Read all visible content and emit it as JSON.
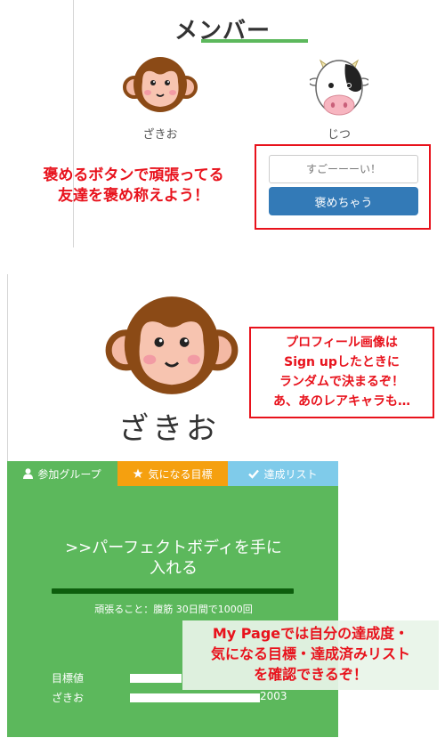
{
  "members_panel": {
    "title": "メンバー",
    "members": [
      {
        "name": "ざきお",
        "avatar": "monkey-icon"
      },
      {
        "name": "じつ",
        "avatar": "cow-icon"
      }
    ],
    "praise_input": {
      "placeholder": "すごーーーい！",
      "value": ""
    },
    "praise_button_label": "褒めちゃう",
    "callout_lines": [
      "褒めるボタンで頑張ってる",
      "友達を褒め称えよう！"
    ]
  },
  "profile_panel": {
    "avatar": "monkey-icon",
    "name": "ざきお",
    "callout_lines": [
      "プロフィール画像は",
      "Sign upしたときに",
      "ランダムで決まるぞ！",
      "あ、あのレアキャラも…"
    ],
    "tabs": [
      {
        "label": "参加グループ",
        "icon": "user-icon",
        "color": "#5cb85c"
      },
      {
        "label": "気になる目標",
        "icon": "star-icon",
        "color": "#f5a00f"
      },
      {
        "label": "達成リスト",
        "icon": "check-icon",
        "color": "#7fcbea"
      }
    ],
    "goal": {
      "title_line1": ">>パーフェクトボディを手に",
      "title_line2": "入れる",
      "effort_text": "頑張ること：腹筋 30日間で1000回",
      "progress_fraction": 1.0
    },
    "stats": {
      "target_label": "目標値",
      "target_fraction": 0.4,
      "member_label": "ざきお",
      "member_fraction": 1.0,
      "member_value": "2003"
    },
    "callout3_lines": [
      "My Pageでは自分の達成度・",
      "気になる目標・達成済みリスト",
      "を確認できるぞ！"
    ]
  },
  "colors": {
    "accent_green": "#5cb85c",
    "button_blue": "#337ab7",
    "callout_red": "#e8121c",
    "tab_orange": "#f5a00f",
    "tab_blue": "#7fcbea"
  }
}
